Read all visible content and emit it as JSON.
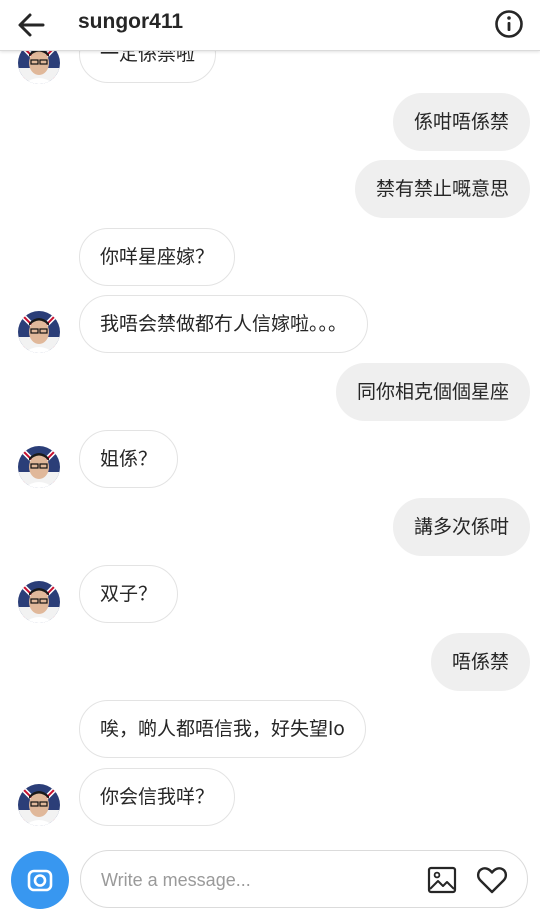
{
  "header": {
    "username": "sungor411",
    "back_icon": "back-arrow-icon",
    "info_icon": "info-icon"
  },
  "messages": [
    {
      "side": "received",
      "text": "一定係禁啦",
      "avatar": true
    },
    {
      "side": "sent",
      "text": "係咁唔係禁"
    },
    {
      "side": "sent",
      "text": "禁有禁止嘅意思"
    },
    {
      "side": "received",
      "text": "你咩星座嫁？",
      "avatar": false
    },
    {
      "side": "received",
      "text": "我唔会禁做都冇人信嫁啦。。。",
      "avatar": true
    },
    {
      "side": "sent",
      "text": "同你相克個個星座"
    },
    {
      "side": "received",
      "text": "姐係？",
      "avatar": true
    },
    {
      "side": "sent",
      "text": "講多次係咁"
    },
    {
      "side": "received",
      "text": "双子？",
      "avatar": true
    },
    {
      "side": "sent",
      "text": "唔係禁"
    },
    {
      "side": "received",
      "text": "唉，啲人都唔信我，好失望lo",
      "avatar": false
    },
    {
      "side": "received",
      "text": "你会信我咩？",
      "avatar": true
    }
  ],
  "composer": {
    "placeholder": "Write a message...",
    "camera_icon": "camera-icon",
    "gallery_icon": "gallery-icon",
    "heart_icon": "heart-icon"
  },
  "colors": {
    "accent": "#3897f0",
    "sent_bubble": "#efefef",
    "received_border": "#e3e3e3"
  }
}
